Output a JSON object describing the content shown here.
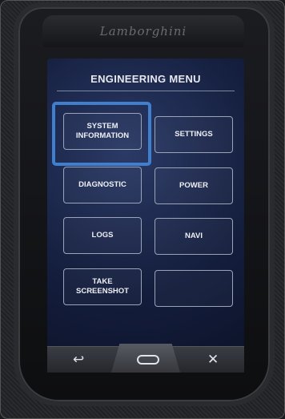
{
  "logo": {
    "text": "Lamborghini"
  },
  "menu": {
    "title": "ENGINEERING MENU",
    "buttons": [
      {
        "label": "SYSTEM\nINFORMATION",
        "highlighted": true
      },
      {
        "label": "SETTINGS"
      },
      {
        "label": "DIAGNOSTIC"
      },
      {
        "label": "POWER"
      },
      {
        "label": "LOGS"
      },
      {
        "label": "NAVI"
      },
      {
        "label": "TAKE\nSCREENSHOT"
      },
      {
        "label": ""
      }
    ]
  },
  "navbar": {
    "back_icon": "↩",
    "home_icon": "home-pill",
    "close_icon": "✕"
  },
  "colors": {
    "highlight": "#3f7fce",
    "screen_bg": "#141e3d"
  }
}
